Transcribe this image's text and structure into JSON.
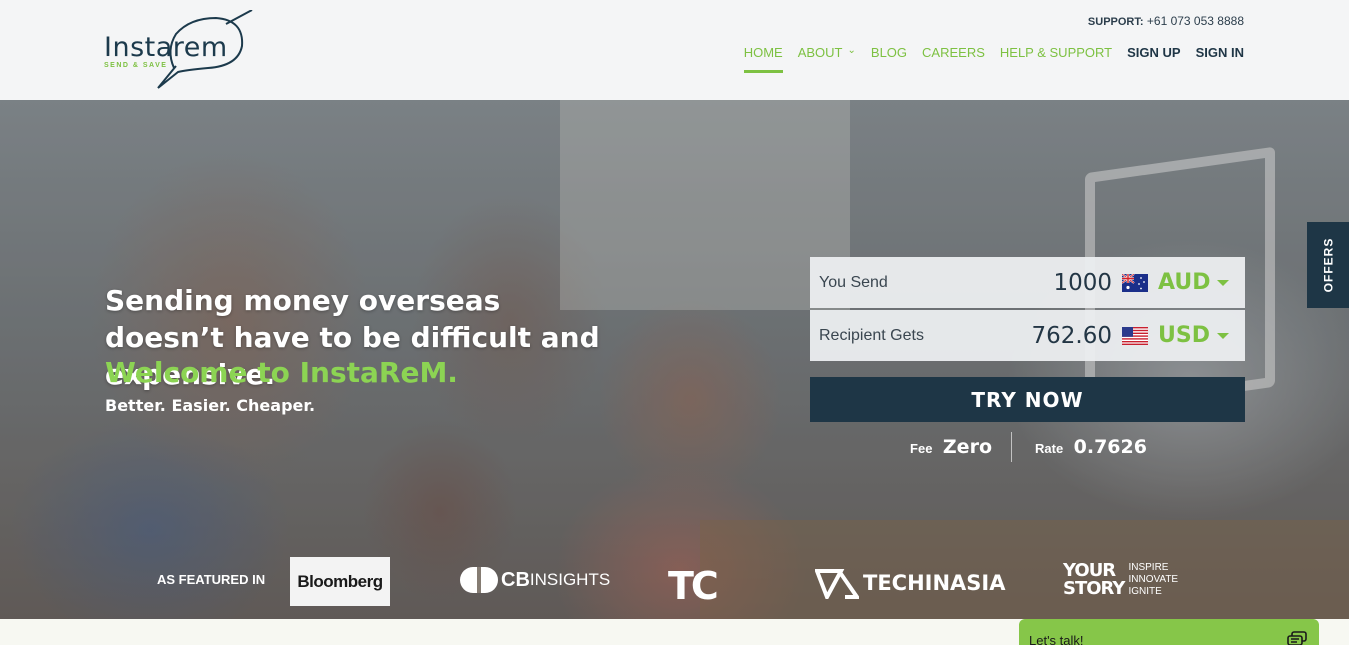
{
  "brand": {
    "name": "Instarem",
    "tagline": "SEND & SAVE",
    "green": "#7dc142",
    "navy": "#1e3646"
  },
  "support": {
    "label": "SUPPORT:",
    "phone": "+61 073 053 8888"
  },
  "nav": {
    "home": "HOME",
    "about": "ABOUT",
    "blog": "BLOG",
    "careers": "CAREERS",
    "help": "HELP & SUPPORT",
    "signup": "SIGN UP",
    "signin": "SIGN IN"
  },
  "hero": {
    "headline": "Sending money overseas doesn’t have to be difficult and expensive.",
    "welcome": "Welcome to InstaReM.",
    "tagline": "Better. Easier. Cheaper."
  },
  "converter": {
    "send_label": "You Send",
    "send_amount": "1000",
    "send_currency": "AUD",
    "send_flag": "australia-flag-icon",
    "get_label": "Recipient Gets",
    "get_amount": "762.60",
    "get_currency": "USD",
    "get_flag": "usa-flag-icon",
    "cta": "TRY NOW",
    "fee_label": "Fee",
    "fee_value": "Zero",
    "rate_label": "Rate",
    "rate_value": "0.7626"
  },
  "offers": "OFFERS",
  "featured": {
    "label": "AS FEATURED IN",
    "bloomberg": "Bloomberg",
    "cb_main": "CB",
    "cb_rest": "INSIGHTS",
    "tc": "TC",
    "tia": "TECHINASIA",
    "ys_main_1": "YOUR",
    "ys_main_2": "STORY",
    "ys_sub_1": "INSPIRE",
    "ys_sub_2": "INNOVATE",
    "ys_sub_3": "IGNITE"
  },
  "chat": {
    "label": "Let's talk!"
  }
}
